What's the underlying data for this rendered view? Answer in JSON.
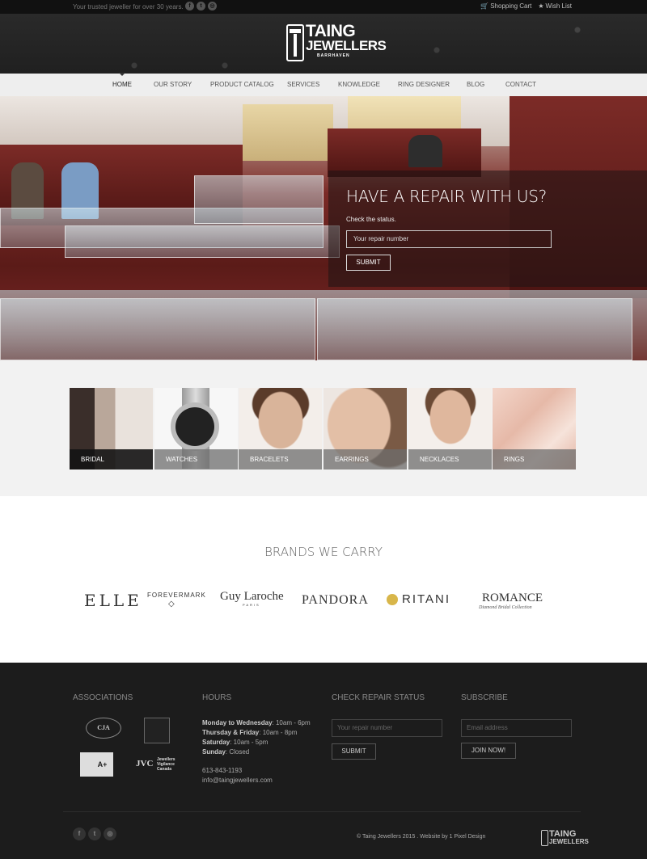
{
  "topbar": {
    "tagline": "Your trusted jeweller for over 30 years.",
    "socials": [
      {
        "icon": "facebook-icon",
        "glyph": "f"
      },
      {
        "icon": "twitter-icon",
        "glyph": "t"
      },
      {
        "icon": "instagram-icon",
        "glyph": "◎"
      }
    ],
    "shopping_cart": "Shopping Cart",
    "wish_list": "Wish List"
  },
  "logo": {
    "line1": "TAING",
    "line2": "JEWELLERS",
    "line3": "BARRHAVEN"
  },
  "nav": {
    "items": [
      {
        "label": "HOME",
        "active": true
      },
      {
        "label": "OUR STORY"
      },
      {
        "label": "PRODUCT CATALOG"
      },
      {
        "label": "SERVICES"
      },
      {
        "label": "KNOWLEDGE"
      },
      {
        "label": "RING DESIGNER"
      },
      {
        "label": "BLOG"
      },
      {
        "label": "CONTACT"
      }
    ]
  },
  "hero": {
    "title": "HAVE A REPAIR WITH US?",
    "subtitle": "Check the status.",
    "input_placeholder": "Your repair number",
    "submit": "SUBMIT"
  },
  "categories": [
    {
      "label": "BRIDAL"
    },
    {
      "label": "WATCHES"
    },
    {
      "label": "BRACELETS"
    },
    {
      "label": "EARRINGS"
    },
    {
      "label": "NECKLACES"
    },
    {
      "label": "RINGS"
    }
  ],
  "brands": {
    "heading": "BRANDS WE CARRY",
    "items": [
      "ELLE",
      "FOREVERMARK",
      "Guy Laroche",
      "PANDORA",
      "RITANI",
      "ROMANCE"
    ],
    "sublines": {
      "guy_laroche": "PARIS",
      "romance": "Diamond Bridal Collection"
    }
  },
  "footer": {
    "associations_heading": "ASSOCIATIONS",
    "assoc_badges": {
      "cja": "CJA",
      "bbb": "A+",
      "jvc": "JVC",
      "jvc_text": "Jewellers Vigilance Canada"
    },
    "hours_heading": "HOURS",
    "hours": [
      {
        "day": "Monday to Wednesday",
        "time": ": 10am - 6pm"
      },
      {
        "day": "Thursday & Friday",
        "time": ": 10am - 8pm"
      },
      {
        "day": "Saturday",
        "time": ": 10am - 5pm"
      },
      {
        "day": "Sunday",
        "time": ": Closed"
      }
    ],
    "phone": "613-843-1193",
    "email": "info@taingjewellers.com",
    "repair_heading": "CHECK REPAIR STATUS",
    "repair_placeholder": "Your repair number",
    "repair_submit": "SUBMIT",
    "subscribe_heading": "SUBSCRIBE",
    "subscribe_placeholder": "Email address",
    "subscribe_button": "JOIN NOW!",
    "copyright": "© Taing Jewellers 2015 . Website by 1 Pixel Design",
    "logo_line1": "TAING",
    "logo_line2": "JEWELLERS"
  }
}
